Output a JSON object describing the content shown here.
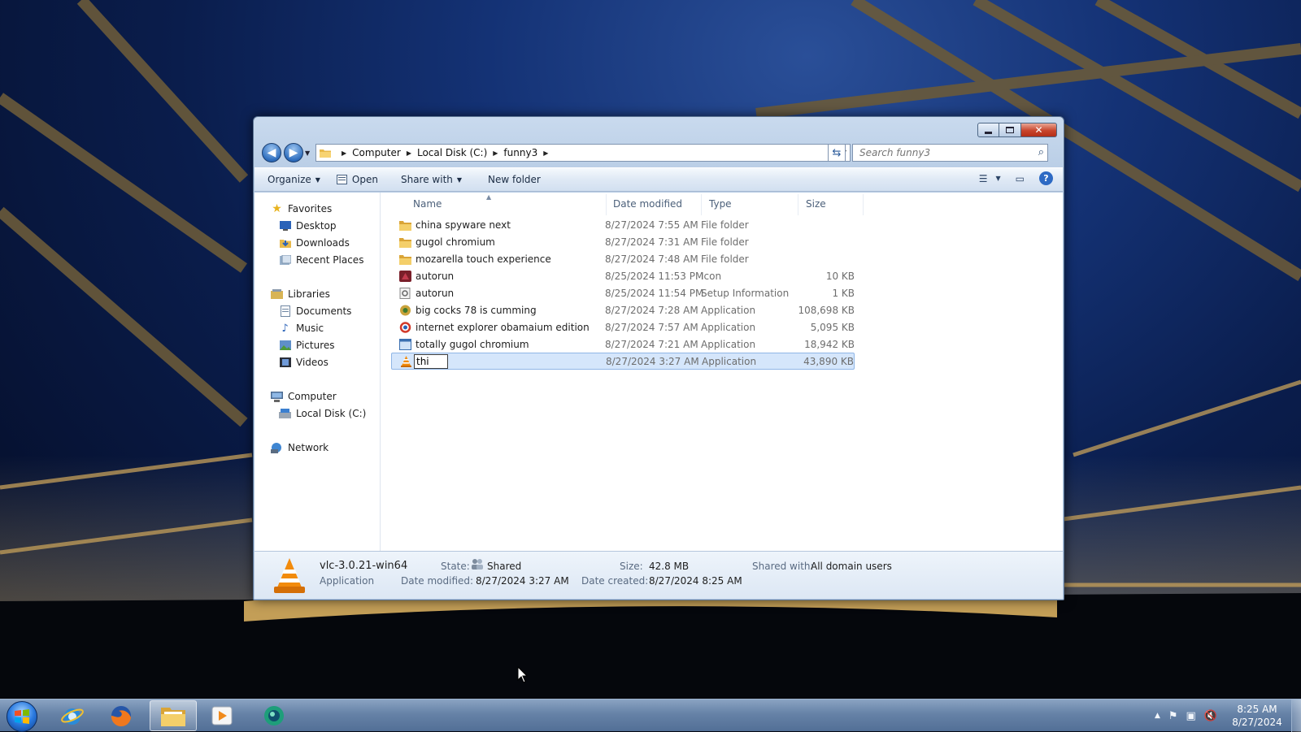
{
  "window": {
    "address": [
      "Computer",
      "Local Disk (C:)",
      "funny3"
    ],
    "search_placeholder": "Search funny3"
  },
  "toolbar": {
    "organize": "Organize",
    "open": "Open",
    "share_with": "Share with",
    "new_folder": "New folder"
  },
  "nav": {
    "favorites": "Favorites",
    "desktop": "Desktop",
    "downloads": "Downloads",
    "recent_places": "Recent Places",
    "libraries": "Libraries",
    "documents": "Documents",
    "music": "Music",
    "pictures": "Pictures",
    "videos": "Videos",
    "computer": "Computer",
    "local_disk": "Local Disk (C:)",
    "network": "Network"
  },
  "columns": {
    "name": "Name",
    "date_modified": "Date modified",
    "type": "Type",
    "size": "Size"
  },
  "files": [
    {
      "name": "china spyware next",
      "date": "8/27/2024 7:55 AM",
      "type": "File folder",
      "size": "",
      "icon": "folder-icon"
    },
    {
      "name": "gugol chromium",
      "date": "8/27/2024 7:31 AM",
      "type": "File folder",
      "size": "",
      "icon": "folder-icon"
    },
    {
      "name": "mozarella touch experience",
      "date": "8/27/2024 7:48 AM",
      "type": "File folder",
      "size": "",
      "icon": "folder-icon"
    },
    {
      "name": "autorun",
      "date": "8/25/2024 11:53 PM",
      "type": "Icon",
      "size": "10 KB",
      "icon": "icon-file-icon"
    },
    {
      "name": "autorun",
      "date": "8/25/2024 11:54 PM",
      "type": "Setup Information",
      "size": "1 KB",
      "icon": "setup-info-icon"
    },
    {
      "name": "big cocks 78 is cumming",
      "date": "8/27/2024 7:28 AM",
      "type": "Application",
      "size": "108,698 KB",
      "icon": "installer-icon"
    },
    {
      "name": "internet explorer obamaium edition",
      "date": "8/27/2024 7:57 AM",
      "type": "Application",
      "size": "5,095 KB",
      "icon": "ie-app-icon"
    },
    {
      "name": "totally gugol chromium",
      "date": "8/27/2024 7:21 AM",
      "type": "Application",
      "size": "18,942 KB",
      "icon": "app-window-icon"
    },
    {
      "name": "",
      "date": "8/27/2024 3:27 AM",
      "type": "Application",
      "size": "43,890 KB",
      "icon": "vlc-cone-icon",
      "renaming": true
    }
  ],
  "rename_value": "thi",
  "details": {
    "name": "vlc-3.0.21-win64",
    "kind": "Application",
    "state_label": "State:",
    "state": "Shared",
    "size_label": "Size:",
    "size": "42.8 MB",
    "shared_label": "Shared with:",
    "shared": "All domain users",
    "modified_label": "Date modified:",
    "modified": "8/27/2024 3:27 AM",
    "created_label": "Date created:",
    "created": "8/27/2024 8:25 AM"
  },
  "taskbar": {
    "time": "8:25 AM",
    "date": "8/27/2024",
    "apps": [
      "internet-explorer-icon",
      "firefox-icon",
      "windows-explorer-icon",
      "media-player-icon",
      "app-globe-icon"
    ]
  },
  "colors": {
    "accent": "#2d6ac4",
    "selection": "#d5e6fb",
    "close_button": "#c8452c"
  }
}
